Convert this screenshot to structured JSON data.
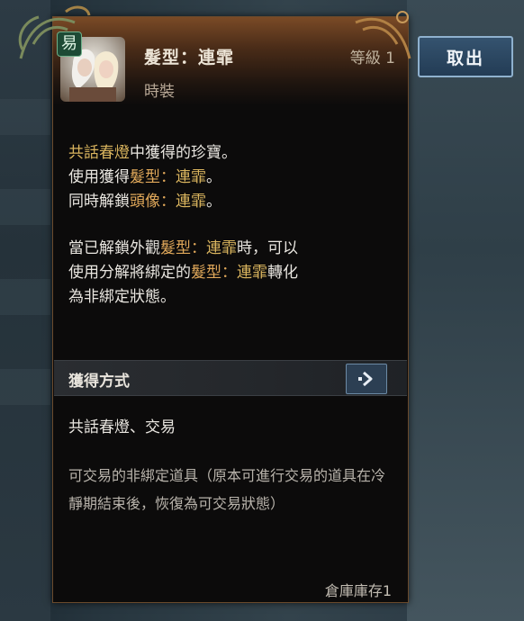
{
  "item": {
    "trade_badge": "易",
    "name": "髮型：連霏",
    "type": "時裝",
    "level": "等級 1"
  },
  "description": {
    "line1": {
      "source": "共話春燈",
      "rest": "中獲得的珍寶。"
    },
    "line2": {
      "prefix": "使用獲得",
      "type": "髮型：",
      "name": "連霏",
      "suffix": "。"
    },
    "line3": {
      "prefix": "同時解鎖",
      "type": "頭像：",
      "name": "連霏",
      "suffix": "。"
    },
    "para2": {
      "a": "當已解鎖外觀",
      "type1": "髮型：",
      "name1": "連霏",
      "b": "時，可以",
      "c": "使用分解將綁定的",
      "type2": "髮型：",
      "name2": "連霏",
      "d": "轉化",
      "e": "為非綁定狀態。"
    }
  },
  "acquire": {
    "title": "獲得方式",
    "sources": "共話春燈、交易"
  },
  "trade_note": "可交易的非綁定道具（原本可進行交易的道具在冷靜期結束後，恢復為可交易狀態）",
  "storage": "倉庫庫存1",
  "actions": {
    "take_out": "取出"
  },
  "colors": {
    "highlight_gold": "#d9b45e",
    "highlight_orange": "#e0a85a",
    "button_blue": "#2c4762"
  },
  "icons": {
    "trade_badge": "trade-icon",
    "section_button": "arrow-right-icon"
  }
}
